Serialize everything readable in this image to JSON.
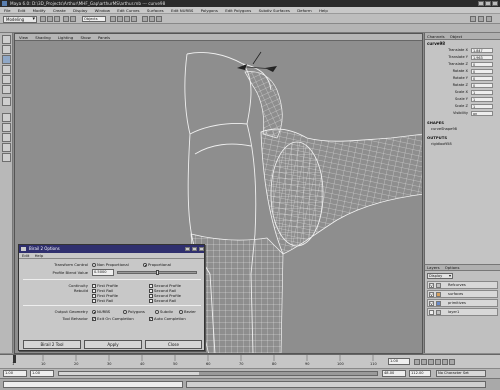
{
  "window": {
    "title": "Maya 6.0: D:\\3D_Projects\\Arthur\\MHF_Gap\\arthurMS\\arthur.mb  ---  curve98"
  },
  "menubar": [
    "File",
    "Edit",
    "Modify",
    "Create",
    "Display",
    "Window",
    "Edit Curves",
    "Surfaces",
    "Edit NURBS",
    "Polygons",
    "Edit Polygons",
    "Subdiv Surfaces",
    "Deform",
    "Help"
  ],
  "status_line": {
    "mode": "Modeling",
    "object_field": "Objects"
  },
  "viewport": {
    "menu": [
      "View",
      "Shading",
      "Lighting",
      "Show",
      "Panels"
    ]
  },
  "channel_box": {
    "tabs": [
      "Channels",
      "Object"
    ],
    "object_name": "curve98",
    "channels": [
      {
        "label": "Translate X",
        "value": "1.847"
      },
      {
        "label": "Translate Y",
        "value": "1.963"
      },
      {
        "label": "Translate Z",
        "value": "0"
      },
      {
        "label": "Rotate X",
        "value": "0"
      },
      {
        "label": "Rotate Y",
        "value": "0"
      },
      {
        "label": "Rotate Z",
        "value": "0"
      },
      {
        "label": "Scale X",
        "value": "1"
      },
      {
        "label": "Scale Y",
        "value": "1"
      },
      {
        "label": "Scale Z",
        "value": "1"
      },
      {
        "label": "Visibility",
        "value": "on"
      }
    ],
    "shapes_title": "SHAPES",
    "shapes": [
      "curveShape98"
    ],
    "outputs_title": "OUTPUTS",
    "outputs": [
      "rigidlooft58"
    ]
  },
  "layers": {
    "tabs": [
      "Layers",
      "Options"
    ],
    "dropdown": "Display",
    "items": [
      {
        "name": "Refcurves",
        "visible": "V",
        "color": "#c0c0c0"
      },
      {
        "name": "surfaces",
        "visible": "V",
        "color": "#d4a060"
      },
      {
        "name": "primitives",
        "visible": "V",
        "color": "#6c8cc8"
      },
      {
        "name": "layer1",
        "visible": "",
        "color": "#c0c0c0"
      }
    ]
  },
  "timeline": {
    "ticks": [
      "1",
      "10",
      "20",
      "30",
      "40",
      "50",
      "60",
      "70",
      "80",
      "90",
      "100",
      "110"
    ],
    "current_frame": "1.00"
  },
  "range_slider": {
    "start": "1.00",
    "inner_start": "1.00",
    "inner_end": "48.00",
    "end": "112.00",
    "character_set": "No Character Set"
  },
  "dialog": {
    "title": "Birail 2 Options",
    "menu": [
      "Edit",
      "Help"
    ],
    "transform_control_label": "Transform Control",
    "transform_options": [
      "Non Proportional",
      "Proportional"
    ],
    "transform_selected": 1,
    "profile_blend_label": "Profile Blend Value",
    "profile_blend_value": "0.5000",
    "profile_blend_fraction": 0.5,
    "continuity_label": "Continuity",
    "continuity_options": [
      "First Profile",
      "Second Profile",
      "First Rail",
      "Second Rail"
    ],
    "continuity_checked": [
      false,
      false,
      false,
      false
    ],
    "rebuild_label": "Rebuild",
    "rebuild_options": [
      "First Profile",
      "Second Profile",
      "First Rail",
      "Second Rail"
    ],
    "rebuild_checked": [
      false,
      false,
      false,
      false
    ],
    "output_geometry_label": "Output Geometry",
    "output_options": [
      "NURBS",
      "Polygons",
      "Subdiv",
      "Bezier"
    ],
    "output_selected": 0,
    "tool_behavior_label": "Tool Behavior",
    "tool_behavior_options": [
      "Exit On Completion",
      "Auto Completion"
    ],
    "tool_behavior_checked": [
      true,
      true
    ],
    "buttons": {
      "run": "Birail 2 Tool",
      "apply": "Apply",
      "close": "Close"
    }
  },
  "colors": {
    "viewport_bg": "#8e8e8e",
    "wire": "#f2f2f2",
    "dialog_title_bg": "#2f2f6e"
  }
}
